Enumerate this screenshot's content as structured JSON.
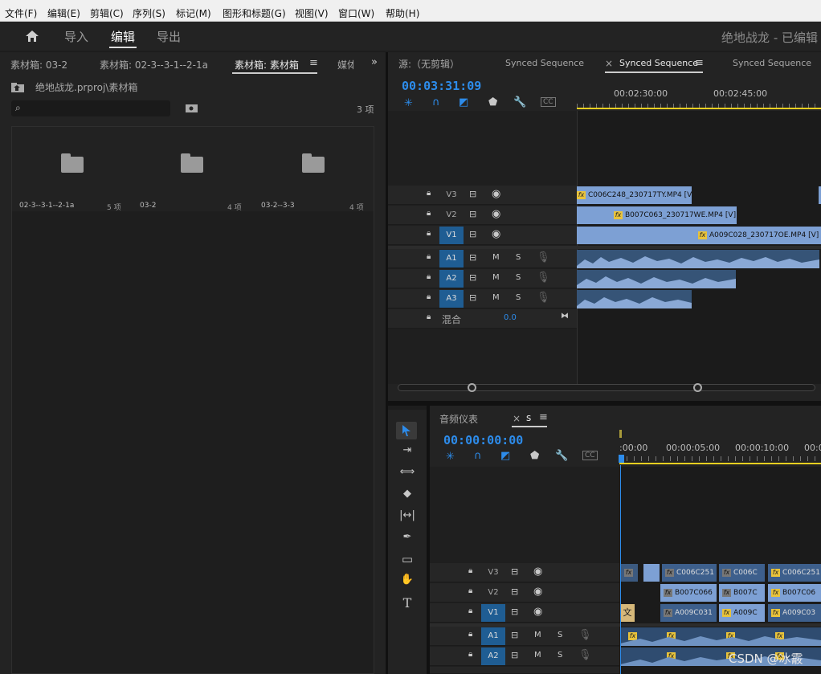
{
  "menubar": {
    "items": [
      "文件(F)",
      "编辑(E)",
      "剪辑(C)",
      "序列(S)",
      "标记(M)",
      "图形和标题(G)",
      "视图(V)",
      "窗口(W)",
      "帮助(H)"
    ]
  },
  "workspace": {
    "tabs": [
      "导入",
      "编辑",
      "导出"
    ],
    "active_tab": "编辑",
    "project_title": "绝地战龙 - 已编辑"
  },
  "project_panel": {
    "tabs": [
      "素材箱: 03-2",
      "素材箱: 02-3--3-1--2-1a",
      "素材箱: 素材箱",
      "媒体"
    ],
    "path": "绝地战龙.prproj\\素材箱",
    "search_placeholder": "",
    "item_count": "3 项",
    "folders": [
      {
        "name": "02-3--3-1--2-1a",
        "count": "5 项"
      },
      {
        "name": "03-2",
        "count": "4 项"
      },
      {
        "name": "03-2--3-3",
        "count": "4 项"
      }
    ]
  },
  "source_panel": {
    "tabs": [
      "源:（无剪辑）",
      "Synced Sequence",
      "Synced Sequence",
      "Synced Sequence"
    ],
    "close_glyph": "×",
    "timecode": "00:03:31:09",
    "ruler": [
      "00:02:30:00",
      "00:02:45:00"
    ],
    "tracks_video": [
      "V3",
      "V2",
      "V1"
    ],
    "tracks_audio": [
      "A1",
      "A2",
      "A3"
    ],
    "audio_buttons": [
      "M",
      "S"
    ],
    "mix_label": "混合",
    "mix_value": "0.0",
    "clips": [
      {
        "label": "C006C248_230717TY.MP4 [V]"
      },
      {
        "label": "B007C063_230717WE.MP4 [V]"
      },
      {
        "label": "A009C028_230717OE.MP4 [V]"
      }
    ]
  },
  "timeline_panel": {
    "tabs": [
      "音频仪表",
      "s"
    ],
    "close_glyph": "×",
    "timecode": "00:00:00:00",
    "ruler": [
      ":00:00",
      "00:00:05:00",
      "00:00:10:00",
      "00:0"
    ],
    "tracks_video": [
      "V3",
      "V2",
      "V1"
    ],
    "tracks_audio": [
      "A1",
      "A2"
    ],
    "audio_buttons": [
      "M",
      "S"
    ],
    "v3_clips": [
      "C006C251",
      "C006C",
      "C006C251"
    ],
    "v2_clips": [
      "B007C066",
      "B007C",
      "B007C06"
    ],
    "v1_clips": [
      "A009C031",
      "A009C",
      "A009C03"
    ],
    "v1_title": "文",
    "fx": "fx"
  },
  "watermark": "CSDN @冰霰",
  "accent_color": "#2d8ceb",
  "playhead_color": "#f0d020"
}
